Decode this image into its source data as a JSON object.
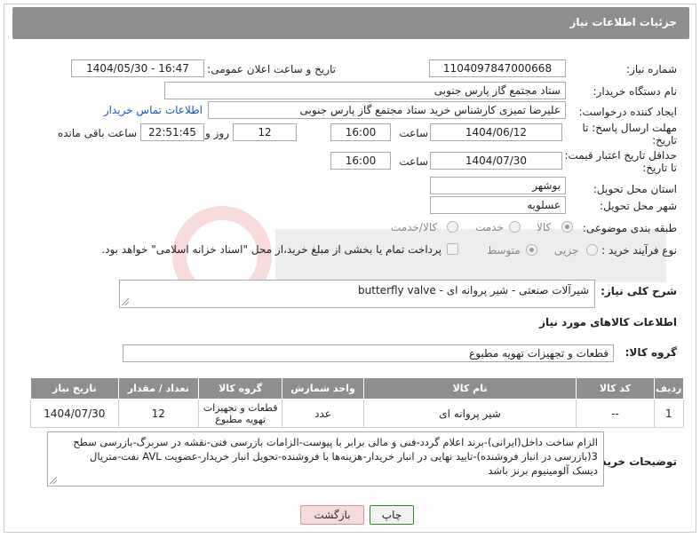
{
  "header": {
    "title": "جزئیات اطلاعات نیاز"
  },
  "fields": {
    "need_number": {
      "label": "شماره نیاز:",
      "value": "1104097847000668"
    },
    "announce_datetime": {
      "label": "تاریخ و ساعت اعلان عمومی:",
      "value": "1404/05/30 - 16:47"
    },
    "buyer_org": {
      "label": "نام دستگاه خریدار:",
      "value": "ستاد مجتمع گاز پارس جنوبی"
    },
    "creator": {
      "label": "ایجاد کننده درخواست:",
      "value": "علیرضا تمیزی کارشناس خرید ستاد مجتمع گاز پارس جنوبی",
      "contact_link": "اطلاعات تماس خریدار"
    },
    "deadline": {
      "label_line1": "مهلت ارسال پاسخ: تا",
      "label_line2": "تاریخ:",
      "date": "1404/06/12",
      "time_label": "ساعت",
      "time": "16:00",
      "days": "12",
      "days_label": "روز و",
      "remaining": "22:51:45",
      "remaining_label": "ساعت باقی مانده"
    },
    "price_validity": {
      "label_line1": "حداقل تاریخ اعتبار قیمت:",
      "label_line2": "تا تاریخ:",
      "date": "1404/07/30",
      "time_label": "ساعت",
      "time": "16:00"
    },
    "province": {
      "label": "استان محل تحویل:",
      "value": "بوشهر"
    },
    "city": {
      "label": "شهر محل تحویل:",
      "value": "عسلویه"
    },
    "category": {
      "label": "طبقه بندی موضوعی:",
      "options": [
        "کالا",
        "خدمت",
        "کالا/خدمت"
      ],
      "selected": "کالا"
    },
    "process_type": {
      "label": "نوع فرآیند خرید :",
      "options": [
        "جزیی",
        "متوسط"
      ],
      "selected": "متوسط",
      "payment_note": "پرداخت تمام یا بخشی از مبلغ خرید،از محل \"اسناد خزانه اسلامی\" خواهد بود."
    }
  },
  "description": {
    "label": "شرح کلی نیاز:",
    "value": "شیرآلات صنعتی - شیر پروانه ای - butterfly valve"
  },
  "goods_section": {
    "title": "اطلاعات کالاهای مورد نیاز"
  },
  "goods_group": {
    "label": "گروه کالا:",
    "value": "قطعات و تجهیزات تهویه مطبوع"
  },
  "table": {
    "headers": [
      "ردیف",
      "کد کالا",
      "نام کالا",
      "واحد شمارش",
      "گروه کالا",
      "تعداد / مقدار",
      "تاریخ نیاز"
    ],
    "rows": [
      [
        "1",
        "--",
        "شیر پروانه ای",
        "عدد",
        "قطعات و تجهیزات تهویه مطبوع",
        "12",
        "1404/07/30"
      ]
    ]
  },
  "buyer_notes": {
    "label": "توضیحات خریدار:",
    "line1": "الزام ساخت داخل(ایرانی)-برند اعلام گردد-فنی و مالی برابر با پیوست-الزامات بازرسی فنی-نقشه در سربرگ-بازرسی سطح",
    "line2": "3(بازرسی در انبار فروشنده)-تایید نهایی در انبار خریدار-هزینه‌ها با فروشنده-تحویل انبار خریدار-عضویت AVL نفت-متریال",
    "line3": "دیسک آلومینیوم برنز باشد"
  },
  "buttons": {
    "print": "چاپ",
    "back": "بازگشت"
  },
  "colors": {
    "header": "#8e8e8e",
    "link": "#1a56c4",
    "back_button": "#f6dada",
    "print_border": "#2a8a2a"
  }
}
